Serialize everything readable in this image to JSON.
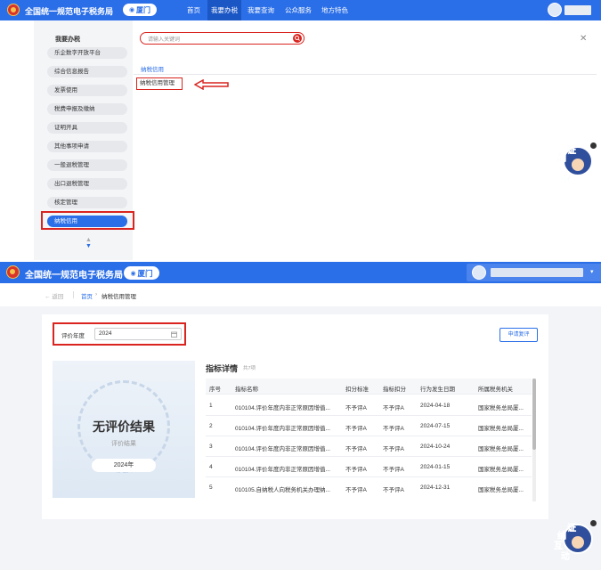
{
  "site": {
    "title": "全国统一规范电子税务局",
    "city": "厦门",
    "colors": {
      "primary": "#2a6ee8",
      "highlight": "#d9241f"
    }
  },
  "nav": {
    "items": [
      "首页",
      "我要办税",
      "我要查询",
      "公众服务",
      "地方特色"
    ],
    "active": "我要办税"
  },
  "sidebar": {
    "heading": "我要办税",
    "items": [
      "乐企数字开放平台",
      "综合信息报告",
      "发票使用",
      "税费申报及缴纳",
      "证明开具",
      "其他事项申请",
      "一般退税管理",
      "出口退税管理",
      "核定管理",
      "纳税信用"
    ],
    "active_index": 9
  },
  "search": {
    "placeholder": "请输入关键词"
  },
  "menu_panel": {
    "category": "纳税信用",
    "result": "纳税信用管理",
    "arrow": "left-arrow-icon"
  },
  "robot": {
    "chars": [
      "证",
      "纳",
      "互",
      "动"
    ]
  },
  "breadcrumb": {
    "back": "返回",
    "home": "首页",
    "separator": "›",
    "current": "纳税信用管理"
  },
  "filter": {
    "label": "评价年度",
    "value": "2024"
  },
  "apply_button": "申请复评",
  "result_card": {
    "title": "无评价结果",
    "subtitle": "评价结果",
    "year": "2024年"
  },
  "table": {
    "title": "指标详情",
    "count": "共7项",
    "headers": [
      "序号",
      "指标名称",
      "扣分标准",
      "指标扣分",
      "行为发生日期",
      "所属税务机关"
    ],
    "rows": [
      [
        "1",
        "010104.评价年度内非正常原因增值...",
        "不予评A",
        "不予评A",
        "2024-04-18",
        "国家税务总局厦..."
      ],
      [
        "2",
        "010104.评价年度内非正常原因增值...",
        "不予评A",
        "不予评A",
        "2024-07-15",
        "国家税务总局厦..."
      ],
      [
        "3",
        "010104.评价年度内非正常原因增值...",
        "不予评A",
        "不予评A",
        "2024-10-24",
        "国家税务总局厦..."
      ],
      [
        "4",
        "010104.评价年度内非正常原因增值...",
        "不予评A",
        "不予评A",
        "2024-01-15",
        "国家税务总局厦..."
      ],
      [
        "5",
        "010105.自纳税人向税务机关办理纳...",
        "不予评A",
        "不予评A",
        "2024-12-31",
        "国家税务总局厦..."
      ]
    ]
  }
}
